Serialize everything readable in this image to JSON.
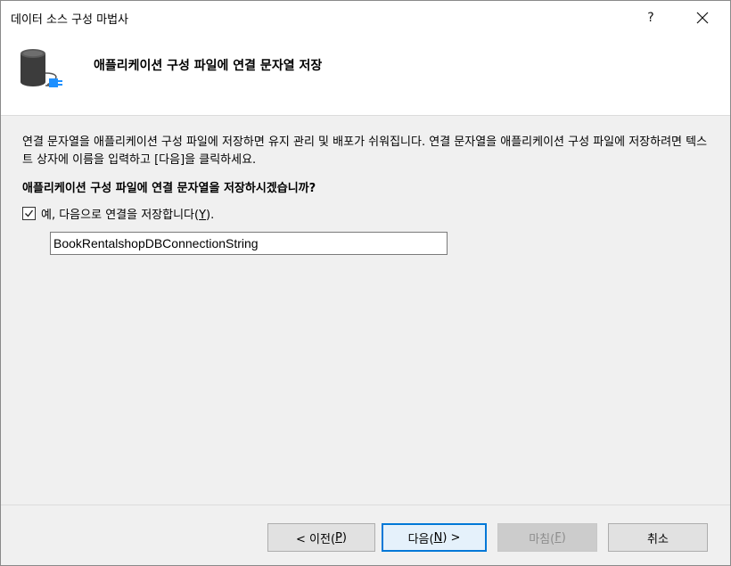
{
  "window": {
    "title": "데이터 소스 구성 마법사",
    "help_label": "?",
    "close_label": "close"
  },
  "header": {
    "title": "애플리케이션 구성 파일에 연결 문자열 저장",
    "icon": "database-plug-icon"
  },
  "content": {
    "description": "연결 문자열을 애플리케이션 구성 파일에 저장하면 유지 관리 및 배포가 쉬워집니다. 연결 문자열을 애플리케이션 구성 파일에 저장하려면 텍스트 상자에 이름을 입력하고 [다음]을 클릭하세요.",
    "question": "애플리케이션 구성 파일에 연결 문자열을 저장하시겠습니까?",
    "save_checkbox": {
      "label_prefix": "예, 다음으로 연결을 저장합니다(",
      "label_mnemonic": "Y",
      "label_suffix": ").",
      "checked": true
    },
    "connection_name": {
      "value": "BookRentalshopDBConnectionString"
    }
  },
  "buttons": {
    "prev": {
      "prefix": "< 이전(",
      "mnemonic": "P",
      "suffix": ")"
    },
    "next": {
      "prefix": "다음(",
      "mnemonic": "N",
      "suffix": ") >"
    },
    "finish": {
      "prefix": "마침(",
      "mnemonic": "F",
      "suffix": ")",
      "enabled": false
    },
    "cancel": {
      "label": "취소"
    }
  },
  "colors": {
    "accent": "#0078d7",
    "dialog_bg": "#f0f0f0",
    "header_bg": "#ffffff"
  }
}
